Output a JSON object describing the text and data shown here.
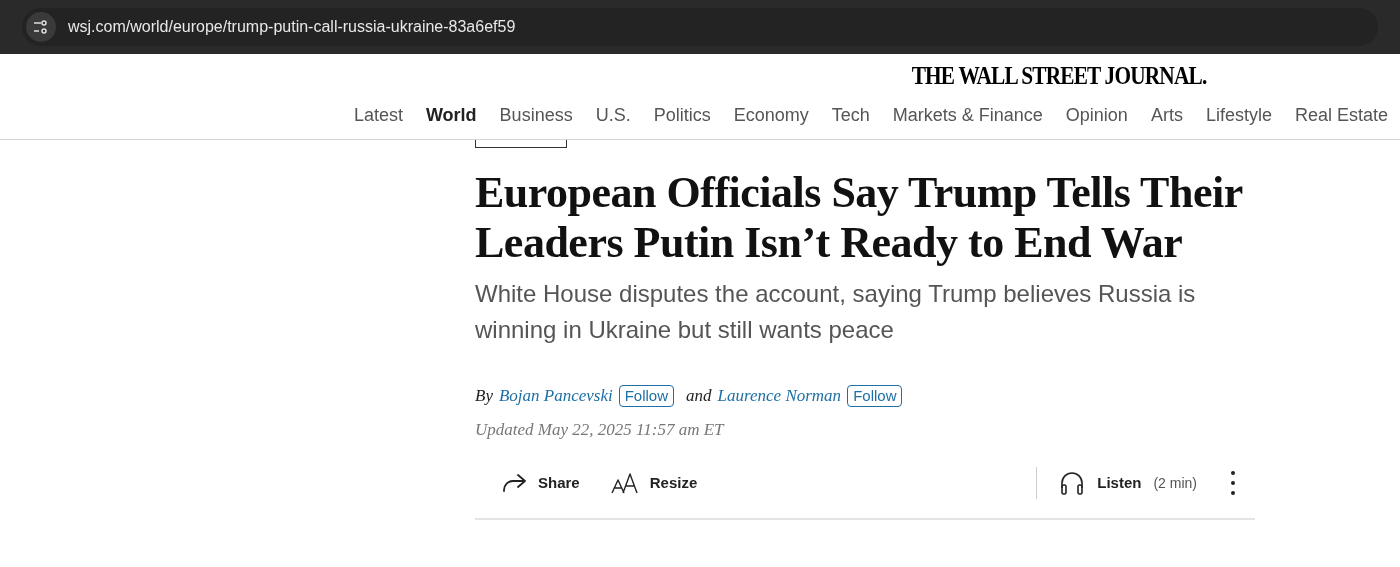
{
  "browser": {
    "url": "wsj.com/world/europe/trump-putin-call-russia-ukraine-83a6ef59"
  },
  "masthead": {
    "logo": "THE WALL STREET JOURNAL."
  },
  "nav": [
    {
      "label": "Latest",
      "selected": false
    },
    {
      "label": "World",
      "selected": true
    },
    {
      "label": "Business",
      "selected": false
    },
    {
      "label": "U.S.",
      "selected": false
    },
    {
      "label": "Politics",
      "selected": false
    },
    {
      "label": "Economy",
      "selected": false
    },
    {
      "label": "Tech",
      "selected": false
    },
    {
      "label": "Markets & Finance",
      "selected": false
    },
    {
      "label": "Opinion",
      "selected": false
    },
    {
      "label": "Arts",
      "selected": false
    },
    {
      "label": "Lifestyle",
      "selected": false
    },
    {
      "label": "Real Estate",
      "selected": false
    }
  ],
  "article": {
    "headline": "European Officials Say Trump Tells Their Leaders Putin Isn’t Ready to End War",
    "dek": "White House disputes the account, saying Trump believes Russia is winning in Ukraine but still wants peace",
    "byline": {
      "prefix": "By",
      "connector": "and",
      "authors": [
        {
          "name": "Bojan Pancevski",
          "follow": "Follow"
        },
        {
          "name": "Laurence Norman",
          "follow": "Follow"
        }
      ]
    },
    "updated": "Updated May 22, 2025 11:57 am ET"
  },
  "toolbar": {
    "actions": [
      {
        "kind": "share",
        "label": "Share"
      },
      {
        "kind": "resize",
        "label": "Resize"
      }
    ],
    "listen": {
      "label": "Listen",
      "duration": "(2 min)"
    }
  }
}
